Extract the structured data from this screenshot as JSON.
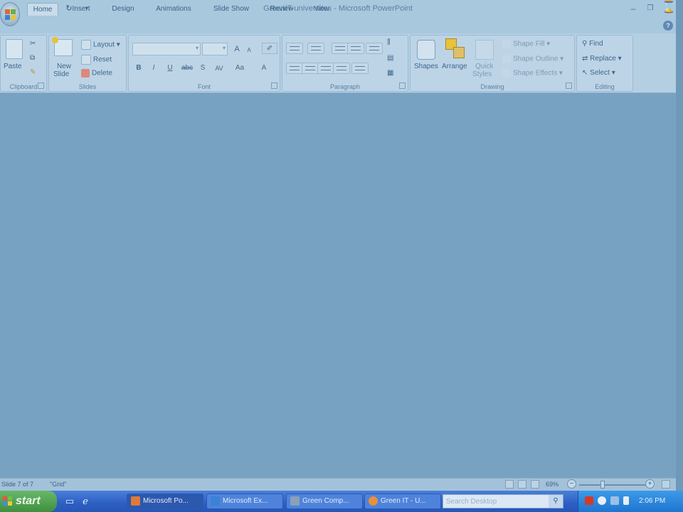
{
  "window": {
    "title": "GreenIT-universites - Microsoft PowerPoint"
  },
  "quick_access": {
    "icons": [
      "save-icon",
      "undo-icon",
      "redo-icon",
      "customize-qat-icon"
    ]
  },
  "tabs": [
    {
      "label": "Home",
      "active": true
    },
    {
      "label": "Insert"
    },
    {
      "label": "Design"
    },
    {
      "label": "Animations"
    },
    {
      "label": "Slide Show"
    },
    {
      "label": "Review"
    },
    {
      "label": "View"
    }
  ],
  "ribbon": {
    "clipboard": {
      "label": "Clipboard",
      "paste_label": "Paste"
    },
    "slides": {
      "label": "Slides",
      "new_slide_line1": "New",
      "new_slide_line2": "Slide",
      "layout_label": "Layout",
      "reset_label": "Reset",
      "delete_label": "Delete"
    },
    "font": {
      "label": "Font",
      "grow_label": "A",
      "shrink_label": "A",
      "bold_label": "B",
      "italic_label": "I",
      "underline_label": "U",
      "strike_label": "abc",
      "shadow_label": "S",
      "spacing_label": "AV",
      "case_label": "Aa",
      "color_label": "A"
    },
    "paragraph": {
      "label": "Paragraph"
    },
    "drawing": {
      "label": "Drawing",
      "shapes_label": "Shapes",
      "arrange_label": "Arrange",
      "quick_styles_line1": "Quick",
      "quick_styles_line2": "Styles",
      "shape_fill_label": "Shape Fill",
      "shape_outline_label": "Shape Outline",
      "shape_effects_label": "Shape Effects"
    },
    "editing": {
      "label": "Editing",
      "find_label": "Find",
      "replace_label": "Replace",
      "select_label": "Select"
    }
  },
  "status": {
    "slide_info": "Slide 7 of 7",
    "theme": "\"Grid\"",
    "zoom": "69%",
    "zoom_fraction": 0.35
  },
  "taskbar": {
    "start_label": "start",
    "tasks": [
      {
        "label": "Microsoft Po...",
        "active": true,
        "color": "#e07a3a"
      },
      {
        "label": "Microsoft Ex...",
        "color": "#3b82d4"
      },
      {
        "label": "Green Comp...",
        "color": "#8aa0b8"
      },
      {
        "label": "Green IT - U...",
        "color": "#e8903a"
      }
    ],
    "search_placeholder": "Search Desktop",
    "clock": "2:06 PM"
  },
  "colors": {
    "accent_ribbon": "#b5cfe2",
    "slide_area": "#78a2c1",
    "taskbar": "#2d5fc3"
  }
}
